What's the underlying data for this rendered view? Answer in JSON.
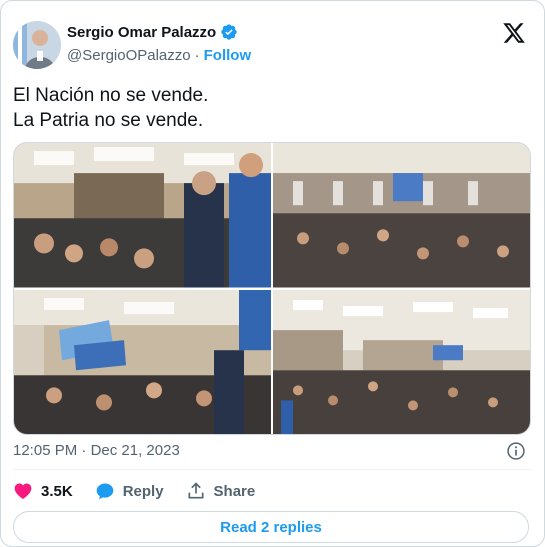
{
  "author": {
    "name": "Sergio Omar Palazzo",
    "handle": "@SergioOPalazzo",
    "separator": "·",
    "follow_label": "Follow"
  },
  "tweet": {
    "line1": "El Nación no se vende.",
    "line2": "La Patria no se vende.",
    "time": "12:05 PM",
    "dot": "·",
    "date": "Dec 21, 2023"
  },
  "photos": [
    {
      "icon": "crowd-photo-1"
    },
    {
      "icon": "crowd-photo-2"
    },
    {
      "icon": "crowd-photo-3"
    },
    {
      "icon": "crowd-photo-4"
    }
  ],
  "actions": {
    "like_count": "3.5K",
    "reply_label": "Reply",
    "share_label": "Share"
  },
  "replies_button": "Read 2 replies",
  "colors": {
    "accent": "#1d9bf0",
    "like": "#f91880",
    "text": "#0f1419",
    "muted": "#536471"
  }
}
